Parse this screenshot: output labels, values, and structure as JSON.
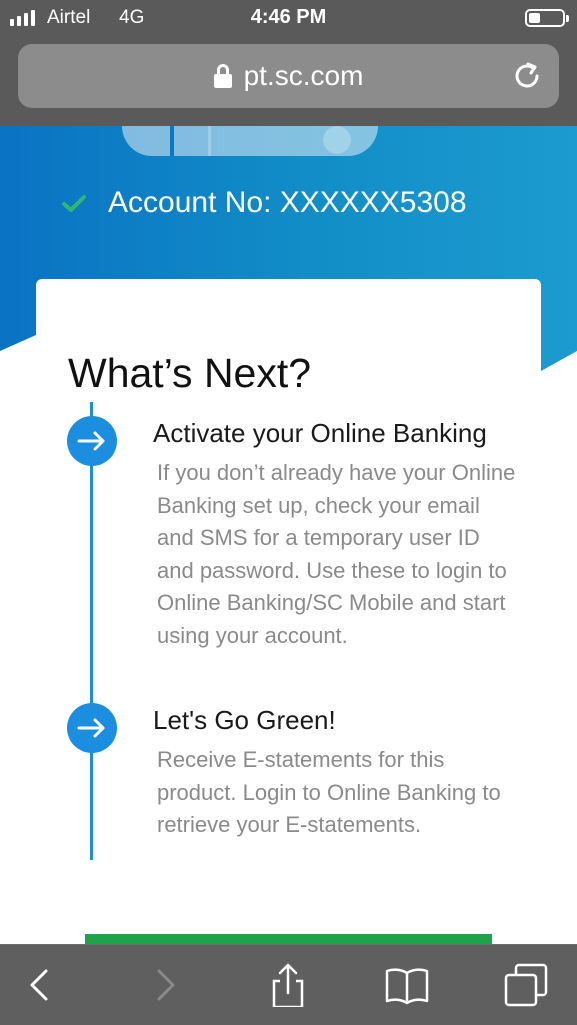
{
  "status_bar": {
    "carrier": "Airtel",
    "network": "4G",
    "time": "4:46 PM",
    "battery_level": 0.35
  },
  "browser": {
    "url": "pt.sc.com",
    "icons": {
      "lock": "lock-icon",
      "reload": "reload-icon"
    }
  },
  "hero": {
    "account_text": "Account No: XXXXXX5308",
    "check_color": "#2eb872",
    "background_color": "#128ec7"
  },
  "card": {
    "heading": "What’s Next?",
    "steps": [
      {
        "title": "Activate your Online Banking",
        "text": "If you don’t already have your Online Banking set up, check your email and SMS for a temporary user ID and password. Use these to login to Online Banking/SC Mobile and start using your account.",
        "icon": "arrow-right-icon"
      },
      {
        "title": "Let's Go Green!",
        "text": "Receive E-statements for this product. Login to Online Banking to retrieve your E-statements.",
        "icon": "arrow-right-icon"
      }
    ],
    "accent_color": "#1b8ee0",
    "button_color": "#1fa34a"
  },
  "toolbar": {
    "icons": [
      "back-icon",
      "forward-icon",
      "share-icon",
      "bookmarks-icon",
      "tabs-icon"
    ]
  }
}
